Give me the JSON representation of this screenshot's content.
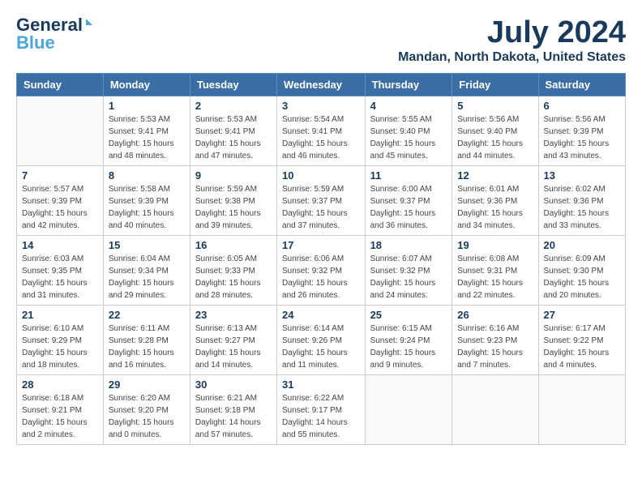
{
  "header": {
    "logo_general": "General",
    "logo_blue": "Blue",
    "title": "July 2024",
    "subtitle": "Mandan, North Dakota, United States"
  },
  "weekdays": [
    "Sunday",
    "Monday",
    "Tuesday",
    "Wednesday",
    "Thursday",
    "Friday",
    "Saturday"
  ],
  "weeks": [
    [
      {
        "day": "",
        "sunrise": "",
        "sunset": "",
        "daylight": ""
      },
      {
        "day": "1",
        "sunrise": "Sunrise: 5:53 AM",
        "sunset": "Sunset: 9:41 PM",
        "daylight": "Daylight: 15 hours and 48 minutes."
      },
      {
        "day": "2",
        "sunrise": "Sunrise: 5:53 AM",
        "sunset": "Sunset: 9:41 PM",
        "daylight": "Daylight: 15 hours and 47 minutes."
      },
      {
        "day": "3",
        "sunrise": "Sunrise: 5:54 AM",
        "sunset": "Sunset: 9:41 PM",
        "daylight": "Daylight: 15 hours and 46 minutes."
      },
      {
        "day": "4",
        "sunrise": "Sunrise: 5:55 AM",
        "sunset": "Sunset: 9:40 PM",
        "daylight": "Daylight: 15 hours and 45 minutes."
      },
      {
        "day": "5",
        "sunrise": "Sunrise: 5:56 AM",
        "sunset": "Sunset: 9:40 PM",
        "daylight": "Daylight: 15 hours and 44 minutes."
      },
      {
        "day": "6",
        "sunrise": "Sunrise: 5:56 AM",
        "sunset": "Sunset: 9:39 PM",
        "daylight": "Daylight: 15 hours and 43 minutes."
      }
    ],
    [
      {
        "day": "7",
        "sunrise": "Sunrise: 5:57 AM",
        "sunset": "Sunset: 9:39 PM",
        "daylight": "Daylight: 15 hours and 42 minutes."
      },
      {
        "day": "8",
        "sunrise": "Sunrise: 5:58 AM",
        "sunset": "Sunset: 9:39 PM",
        "daylight": "Daylight: 15 hours and 40 minutes."
      },
      {
        "day": "9",
        "sunrise": "Sunrise: 5:59 AM",
        "sunset": "Sunset: 9:38 PM",
        "daylight": "Daylight: 15 hours and 39 minutes."
      },
      {
        "day": "10",
        "sunrise": "Sunrise: 5:59 AM",
        "sunset": "Sunset: 9:37 PM",
        "daylight": "Daylight: 15 hours and 37 minutes."
      },
      {
        "day": "11",
        "sunrise": "Sunrise: 6:00 AM",
        "sunset": "Sunset: 9:37 PM",
        "daylight": "Daylight: 15 hours and 36 minutes."
      },
      {
        "day": "12",
        "sunrise": "Sunrise: 6:01 AM",
        "sunset": "Sunset: 9:36 PM",
        "daylight": "Daylight: 15 hours and 34 minutes."
      },
      {
        "day": "13",
        "sunrise": "Sunrise: 6:02 AM",
        "sunset": "Sunset: 9:36 PM",
        "daylight": "Daylight: 15 hours and 33 minutes."
      }
    ],
    [
      {
        "day": "14",
        "sunrise": "Sunrise: 6:03 AM",
        "sunset": "Sunset: 9:35 PM",
        "daylight": "Daylight: 15 hours and 31 minutes."
      },
      {
        "day": "15",
        "sunrise": "Sunrise: 6:04 AM",
        "sunset": "Sunset: 9:34 PM",
        "daylight": "Daylight: 15 hours and 29 minutes."
      },
      {
        "day": "16",
        "sunrise": "Sunrise: 6:05 AM",
        "sunset": "Sunset: 9:33 PM",
        "daylight": "Daylight: 15 hours and 28 minutes."
      },
      {
        "day": "17",
        "sunrise": "Sunrise: 6:06 AM",
        "sunset": "Sunset: 9:32 PM",
        "daylight": "Daylight: 15 hours and 26 minutes."
      },
      {
        "day": "18",
        "sunrise": "Sunrise: 6:07 AM",
        "sunset": "Sunset: 9:32 PM",
        "daylight": "Daylight: 15 hours and 24 minutes."
      },
      {
        "day": "19",
        "sunrise": "Sunrise: 6:08 AM",
        "sunset": "Sunset: 9:31 PM",
        "daylight": "Daylight: 15 hours and 22 minutes."
      },
      {
        "day": "20",
        "sunrise": "Sunrise: 6:09 AM",
        "sunset": "Sunset: 9:30 PM",
        "daylight": "Daylight: 15 hours and 20 minutes."
      }
    ],
    [
      {
        "day": "21",
        "sunrise": "Sunrise: 6:10 AM",
        "sunset": "Sunset: 9:29 PM",
        "daylight": "Daylight: 15 hours and 18 minutes."
      },
      {
        "day": "22",
        "sunrise": "Sunrise: 6:11 AM",
        "sunset": "Sunset: 9:28 PM",
        "daylight": "Daylight: 15 hours and 16 minutes."
      },
      {
        "day": "23",
        "sunrise": "Sunrise: 6:13 AM",
        "sunset": "Sunset: 9:27 PM",
        "daylight": "Daylight: 15 hours and 14 minutes."
      },
      {
        "day": "24",
        "sunrise": "Sunrise: 6:14 AM",
        "sunset": "Sunset: 9:26 PM",
        "daylight": "Daylight: 15 hours and 11 minutes."
      },
      {
        "day": "25",
        "sunrise": "Sunrise: 6:15 AM",
        "sunset": "Sunset: 9:24 PM",
        "daylight": "Daylight: 15 hours and 9 minutes."
      },
      {
        "day": "26",
        "sunrise": "Sunrise: 6:16 AM",
        "sunset": "Sunset: 9:23 PM",
        "daylight": "Daylight: 15 hours and 7 minutes."
      },
      {
        "day": "27",
        "sunrise": "Sunrise: 6:17 AM",
        "sunset": "Sunset: 9:22 PM",
        "daylight": "Daylight: 15 hours and 4 minutes."
      }
    ],
    [
      {
        "day": "28",
        "sunrise": "Sunrise: 6:18 AM",
        "sunset": "Sunset: 9:21 PM",
        "daylight": "Daylight: 15 hours and 2 minutes."
      },
      {
        "day": "29",
        "sunrise": "Sunrise: 6:20 AM",
        "sunset": "Sunset: 9:20 PM",
        "daylight": "Daylight: 15 hours and 0 minutes."
      },
      {
        "day": "30",
        "sunrise": "Sunrise: 6:21 AM",
        "sunset": "Sunset: 9:18 PM",
        "daylight": "Daylight: 14 hours and 57 minutes."
      },
      {
        "day": "31",
        "sunrise": "Sunrise: 6:22 AM",
        "sunset": "Sunset: 9:17 PM",
        "daylight": "Daylight: 14 hours and 55 minutes."
      },
      {
        "day": "",
        "sunrise": "",
        "sunset": "",
        "daylight": ""
      },
      {
        "day": "",
        "sunrise": "",
        "sunset": "",
        "daylight": ""
      },
      {
        "day": "",
        "sunrise": "",
        "sunset": "",
        "daylight": ""
      }
    ]
  ]
}
